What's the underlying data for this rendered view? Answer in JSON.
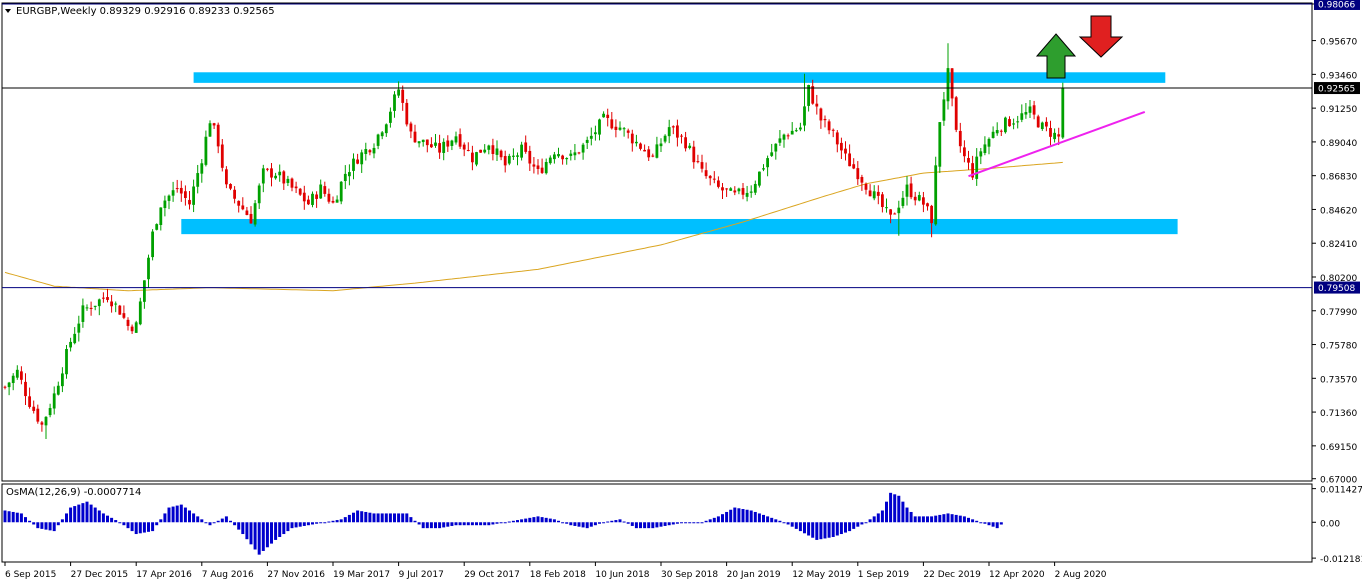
{
  "chart_data": [
    {
      "type": "candlestick",
      "title": "EURGBP,Weekly  0.89329 0.92916 0.89233 0.92565",
      "symbol": "EURGBP",
      "timeframe": "Weekly",
      "ohlc_last": {
        "open": 0.89329,
        "high": 0.92916,
        "low": 0.89233,
        "close": 0.92565
      },
      "ylim": [
        0.6685,
        0.9813
      ],
      "y_ticks": [
        "0.98066",
        "0.95670",
        "0.93460",
        "0.91250",
        "0.89040",
        "0.86830",
        "0.84620",
        "0.82410",
        "0.80200",
        "0.77990",
        "0.75780",
        "0.73570",
        "0.71360",
        "0.69150",
        "0.67000"
      ],
      "price_lines": [
        {
          "label": "0.98066",
          "value": 0.98066,
          "color": "#000080"
        },
        {
          "label": "0.92565",
          "value": 0.92565,
          "color": "#000000"
        },
        {
          "label": "0.79508",
          "value": 0.79508,
          "color": "#000080"
        }
      ],
      "x_ticks": [
        "6 Sep 2015",
        "27 Dec 2015",
        "17 Apr 2016",
        "7 Aug 2016",
        "27 Nov 2016",
        "19 Mar 2017",
        "9 Jul 2017",
        "29 Oct 2017",
        "18 Feb 2018",
        "10 Jun 2018",
        "30 Sep 2018",
        "20 Jan 2019",
        "12 May 2019",
        "1 Sep 2019",
        "22 Dec 2019",
        "12 Apr 2020",
        "2 Aug 2020"
      ],
      "x_tick_index": [
        0,
        16,
        32,
        48,
        64,
        80,
        96,
        112,
        128,
        144,
        160,
        176,
        192,
        208,
        224,
        240,
        256
      ],
      "bar_count": 260,
      "close_anchors": [
        [
          0,
          0.73
        ],
        [
          3,
          0.74
        ],
        [
          6,
          0.72
        ],
        [
          9,
          0.705
        ],
        [
          12,
          0.725
        ],
        [
          16,
          0.76
        ],
        [
          19,
          0.78
        ],
        [
          22,
          0.785
        ],
        [
          25,
          0.79
        ],
        [
          28,
          0.78
        ],
        [
          30,
          0.77
        ],
        [
          32,
          0.77
        ],
        [
          34,
          0.8
        ],
        [
          36,
          0.83
        ],
        [
          38,
          0.85
        ],
        [
          42,
          0.86
        ],
        [
          45,
          0.85
        ],
        [
          48,
          0.88
        ],
        [
          50,
          0.905
        ],
        [
          52,
          0.89
        ],
        [
          54,
          0.86
        ],
        [
          57,
          0.85
        ],
        [
          60,
          0.84
        ],
        [
          63,
          0.87
        ],
        [
          66,
          0.87
        ],
        [
          70,
          0.86
        ],
        [
          74,
          0.85
        ],
        [
          77,
          0.86
        ],
        [
          80,
          0.85
        ],
        [
          83,
          0.87
        ],
        [
          86,
          0.88
        ],
        [
          90,
          0.89
        ],
        [
          93,
          0.905
        ],
        [
          96,
          0.925
        ],
        [
          99,
          0.895
        ],
        [
          102,
          0.89
        ],
        [
          106,
          0.885
        ],
        [
          110,
          0.895
        ],
        [
          114,
          0.88
        ],
        [
          118,
          0.89
        ],
        [
          122,
          0.875
        ],
        [
          126,
          0.885
        ],
        [
          130,
          0.87
        ],
        [
          134,
          0.885
        ],
        [
          138,
          0.88
        ],
        [
          142,
          0.89
        ],
        [
          146,
          0.905
        ],
        [
          150,
          0.9
        ],
        [
          154,
          0.89
        ],
        [
          158,
          0.88
        ],
        [
          162,
          0.9
        ],
        [
          166,
          0.89
        ],
        [
          170,
          0.87
        ],
        [
          174,
          0.86
        ],
        [
          178,
          0.855
        ],
        [
          182,
          0.86
        ],
        [
          186,
          0.88
        ],
        [
          190,
          0.895
        ],
        [
          194,
          0.9
        ],
        [
          196,
          0.925
        ],
        [
          199,
          0.905
        ],
        [
          202,
          0.895
        ],
        [
          205,
          0.88
        ],
        [
          208,
          0.87
        ],
        [
          212,
          0.855
        ],
        [
          216,
          0.84
        ],
        [
          220,
          0.86
        ],
        [
          224,
          0.85
        ],
        [
          226,
          0.84
        ],
        [
          228,
          0.905
        ],
        [
          230,
          0.935
        ],
        [
          232,
          0.895
        ],
        [
          234,
          0.88
        ],
        [
          236,
          0.87
        ],
        [
          238,
          0.885
        ],
        [
          242,
          0.9
        ],
        [
          246,
          0.905
        ],
        [
          250,
          0.91
        ],
        [
          253,
          0.9
        ],
        [
          256,
          0.895
        ],
        [
          257,
          0.8933
        ],
        [
          258,
          0.92565
        ]
      ],
      "sma": {
        "color": "#DAA520",
        "values_at": [
          [
            0,
            0.805
          ],
          [
            12,
            0.796
          ],
          [
            30,
            0.793
          ],
          [
            50,
            0.795
          ],
          [
            80,
            0.793
          ],
          [
            100,
            0.798
          ],
          [
            130,
            0.807
          ],
          [
            160,
            0.823
          ],
          [
            180,
            0.838
          ],
          [
            200,
            0.855
          ],
          [
            210,
            0.863
          ],
          [
            224,
            0.87
          ],
          [
            240,
            0.873
          ],
          [
            258,
            0.877
          ]
        ]
      },
      "zones": [
        {
          "name": "resistance",
          "from": 0.931,
          "to": 0.934,
          "color": "#00BFFF",
          "start_index": 46,
          "end_index": 283
        },
        {
          "name": "support",
          "from": 0.832,
          "to": 0.838,
          "color": "#00BFFF",
          "start_index": 43,
          "end_index": 286
        }
      ],
      "trendline": {
        "color": "#EE22EE",
        "from": [
          235,
          0.868
        ],
        "to": [
          278,
          0.91
        ]
      },
      "signals": [
        {
          "name": "up-arrow",
          "direction": "up",
          "color": "#2E9E2E"
        },
        {
          "name": "down-arrow",
          "direction": "down",
          "color": "#E02020"
        }
      ],
      "colors": {
        "bull": "#00A000",
        "bear": "#E00000"
      }
    },
    {
      "type": "bar",
      "title": "OsMA(12,26,9) -0.0007714",
      "indicator": "OsMA",
      "params": [
        12,
        26,
        9
      ],
      "last_value": -0.0007714,
      "ylim": [
        -0.0135,
        0.013
      ],
      "y_ticks": [
        "0.011427",
        "0.00",
        "-0.012181"
      ],
      "color": "#0000CD",
      "value_anchors": [
        [
          0,
          0.004
        ],
        [
          4,
          0.003
        ],
        [
          8,
          -0.002
        ],
        [
          12,
          -0.003
        ],
        [
          16,
          0.005
        ],
        [
          20,
          0.007
        ],
        [
          24,
          0.003
        ],
        [
          28,
          0.0
        ],
        [
          32,
          -0.004
        ],
        [
          36,
          -0.003
        ],
        [
          40,
          0.005
        ],
        [
          43,
          0.006
        ],
        [
          46,
          0.003
        ],
        [
          50,
          -0.001
        ],
        [
          54,
          0.002
        ],
        [
          58,
          -0.004
        ],
        [
          62,
          -0.011
        ],
        [
          66,
          -0.006
        ],
        [
          70,
          -0.002
        ],
        [
          74,
          -0.001
        ],
        [
          78,
          0.0
        ],
        [
          82,
          0.001
        ],
        [
          86,
          0.004
        ],
        [
          90,
          0.003
        ],
        [
          94,
          0.003
        ],
        [
          98,
          0.003
        ],
        [
          102,
          -0.002
        ],
        [
          106,
          -0.002
        ],
        [
          110,
          -0.001
        ],
        [
          114,
          -0.001
        ],
        [
          118,
          -0.001
        ],
        [
          122,
          0.0
        ],
        [
          126,
          0.001
        ],
        [
          130,
          0.002
        ],
        [
          134,
          0.001
        ],
        [
          138,
          -0.001
        ],
        [
          142,
          -0.002
        ],
        [
          146,
          0.0
        ],
        [
          150,
          0.001
        ],
        [
          154,
          -0.002
        ],
        [
          158,
          -0.002
        ],
        [
          162,
          -0.001
        ],
        [
          166,
          0.0
        ],
        [
          170,
          0.0
        ],
        [
          174,
          0.002
        ],
        [
          178,
          0.005
        ],
        [
          182,
          0.004
        ],
        [
          186,
          0.002
        ],
        [
          190,
          0.0
        ],
        [
          194,
          -0.003
        ],
        [
          198,
          -0.006
        ],
        [
          202,
          -0.005
        ],
        [
          206,
          -0.003
        ],
        [
          210,
          0.0
        ],
        [
          214,
          0.004
        ],
        [
          216,
          0.01
        ],
        [
          218,
          0.009
        ],
        [
          220,
          0.005
        ],
        [
          222,
          0.002
        ],
        [
          226,
          0.002
        ],
        [
          230,
          0.003
        ],
        [
          234,
          0.002
        ],
        [
          238,
          0.0
        ],
        [
          240,
          -0.001
        ],
        [
          242,
          -0.002
        ],
        [
          243,
          -0.0007714
        ]
      ]
    }
  ]
}
